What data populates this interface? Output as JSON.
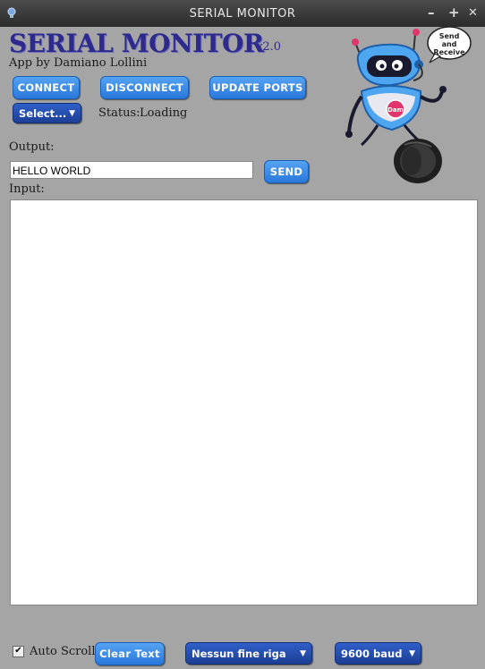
{
  "window": {
    "title": "SERIAL MONITOR",
    "minimize": "–",
    "maximize": "+",
    "close": "✕"
  },
  "header": {
    "title": "SERIAL MONITOR",
    "version": "v2.0",
    "byline": "App by Damiano Lollini"
  },
  "toolbar": {
    "connect": "CONNECT",
    "disconnect": "DISCONNECT",
    "update_ports": "UPDATE PORTS"
  },
  "port_select": {
    "value": "Select...",
    "arrow": "▼"
  },
  "status": {
    "label": "Status:",
    "value": "Loading"
  },
  "output": {
    "label": "Output:",
    "value": "HELLO WORLD",
    "send": "SEND"
  },
  "input": {
    "label": "Input:"
  },
  "footer": {
    "checkmark": "✔",
    "auto_scroll_label": "Auto Scroll",
    "auto_scroll_checked": true,
    "clear_text": "Clear Text",
    "line_ending": "Nessun fine riga",
    "baud": "9600 baud",
    "arrow": "▼"
  },
  "mascot": {
    "speech": [
      "Send",
      "and",
      "Receive"
    ],
    "badge": "Dam"
  },
  "colors": {
    "window_bg": "#a5a5a5",
    "heading": "#2e2a8c",
    "button": "#2a78db",
    "combo": "#1d3f95"
  }
}
